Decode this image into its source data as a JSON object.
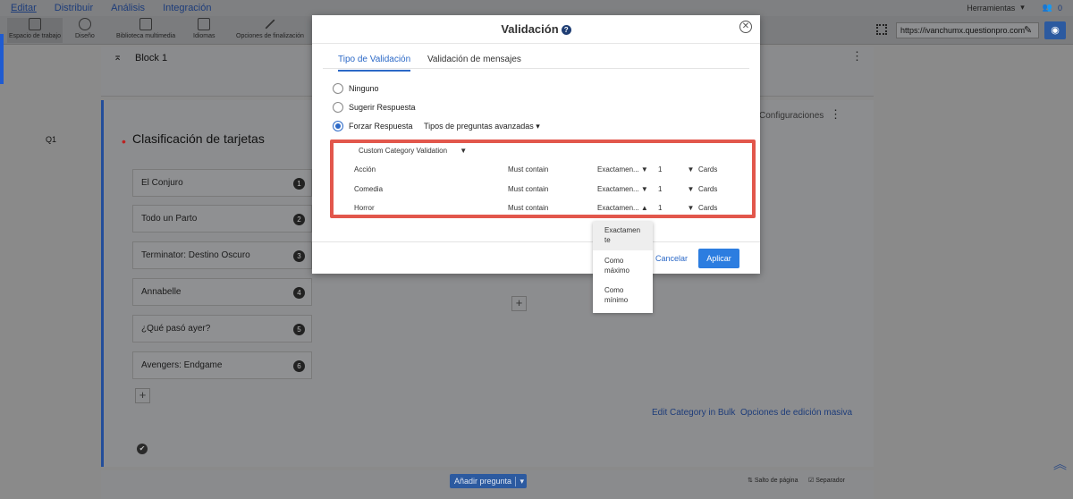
{
  "topmenu": {
    "items": [
      "Editar",
      "Distribuir",
      "Análisis",
      "Integración"
    ],
    "tools_label": "Herramientas",
    "collab_count": "0"
  },
  "toolbar": {
    "items": [
      "Espacio de trabajo",
      "Diseño",
      "Biblioteca multimedia",
      "Idiomas",
      "Opciones de finalización"
    ],
    "url": "https://ivanchumx.questionpro.com"
  },
  "block": {
    "title": "Block 1"
  },
  "question": {
    "label": "Q1",
    "title": "Clasificación de tarjetas",
    "config_label": "Configuraciones",
    "cards": [
      {
        "text": "El Conjuro",
        "num": "1"
      },
      {
        "text": "Todo un Parto",
        "num": "2"
      },
      {
        "text": "Terminator: Destino Oscuro",
        "num": "3"
      },
      {
        "text": "Annabelle",
        "num": "4"
      },
      {
        "text": "¿Qué pasó ayer?",
        "num": "5"
      },
      {
        "text": "Avengers: Endgame",
        "num": "6"
      }
    ],
    "edit_bulk": "Edit Category in Bulk",
    "mass_edit": "Opciones de edición masiva"
  },
  "bottom": {
    "add_question": "Añadir pregunta",
    "page_break": "Salto de página",
    "separator": "Separador"
  },
  "modal": {
    "title": "Validación",
    "tabs": [
      "Tipo de Validación",
      "Validación de mensajes"
    ],
    "radios": [
      "Ninguno",
      "Sugerir Respuesta",
      "Forzar Respuesta"
    ],
    "advanced": "Tipos de preguntas avanzadas",
    "custom_validation": "Custom Category Validation",
    "rows": [
      {
        "category": "Acción",
        "rule": "Must contain",
        "mode": "Exactamen...",
        "count": "1",
        "unit": "Cards"
      },
      {
        "category": "Comedia",
        "rule": "Must contain",
        "mode": "Exactamen...",
        "count": "1",
        "unit": "Cards"
      },
      {
        "category": "Horror",
        "rule": "Must contain",
        "mode": "Exactamen...",
        "count": "1",
        "unit": "Cards"
      }
    ],
    "cancel": "Cancelar",
    "apply": "Aplicar"
  },
  "dropdown": {
    "options": [
      "Exactamen te",
      "Como máximo",
      "Como mínimo"
    ]
  }
}
